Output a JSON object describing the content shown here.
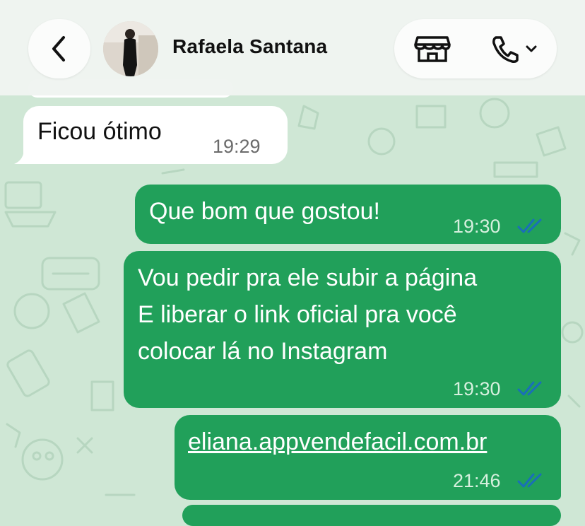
{
  "header": {
    "contact_name": "Rafaela Santana",
    "back_icon": "chevron-left-icon",
    "store_icon": "store-icon",
    "call_icon": "phone-icon",
    "call_menu_icon": "chevron-down-icon"
  },
  "colors": {
    "wallpaper": "#cfe7d5",
    "outgoing_bubble": "#21a05a",
    "incoming_bubble": "#ffffff",
    "read_ticks": "#1a6fb8"
  },
  "messages": [
    {
      "direction": "incoming",
      "text": "Ficou ótimo",
      "time": "19:29"
    },
    {
      "direction": "outgoing",
      "text": "Que bom que gostou!",
      "time": "19:30",
      "status": "read"
    },
    {
      "direction": "outgoing",
      "text": "Vou pedir pra ele subir a página\nE liberar o link oficial pra você\ncolocar lá no Instagram",
      "time": "19:30",
      "status": "read"
    },
    {
      "direction": "outgoing",
      "text": "eliana.appvendefacil.com.br",
      "time": "21:46",
      "status": "read"
    }
  ]
}
